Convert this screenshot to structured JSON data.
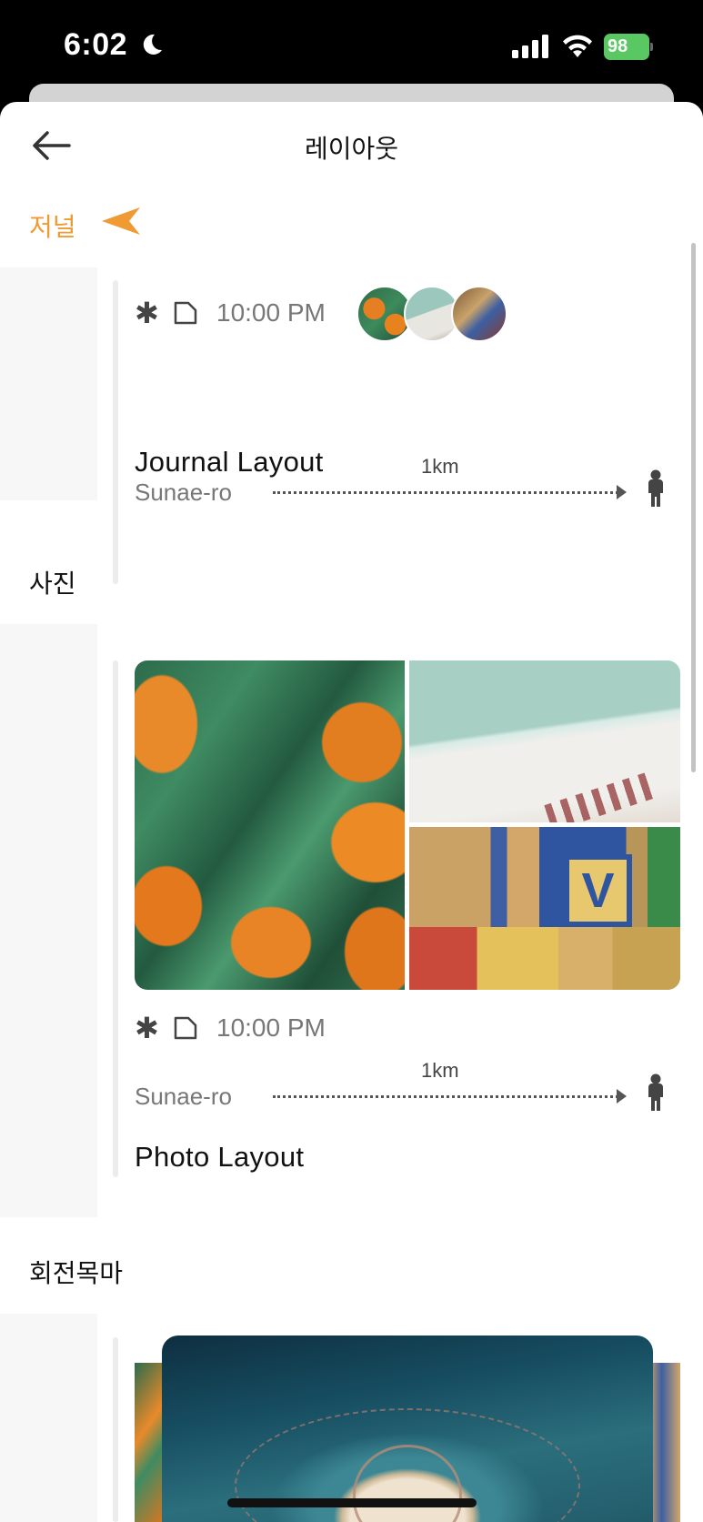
{
  "status_bar": {
    "time": "6:02",
    "battery": "98"
  },
  "nav": {
    "title": "레이아웃"
  },
  "journal_section": {
    "label": "저널"
  },
  "journal_card": {
    "time": "10:00 PM",
    "route_from": "Sunae-ro",
    "distance": "1km",
    "title": "Journal Layout"
  },
  "photo_section": {
    "label": "사진"
  },
  "photo_card": {
    "time": "10:00 PM",
    "route_from": "Sunae-ro",
    "distance": "1km",
    "title": "Photo Layout"
  },
  "carousel_section": {
    "label": "회전목마"
  },
  "colors": {
    "accent": "#ef9a32",
    "battery": "#5ac862"
  },
  "icons": [
    "moon-icon",
    "signal-icon",
    "wifi-icon",
    "battery-icon",
    "back-arrow-icon",
    "orange-arrow-icon",
    "asterisk-icon",
    "square-icon",
    "walking-person-icon"
  ]
}
